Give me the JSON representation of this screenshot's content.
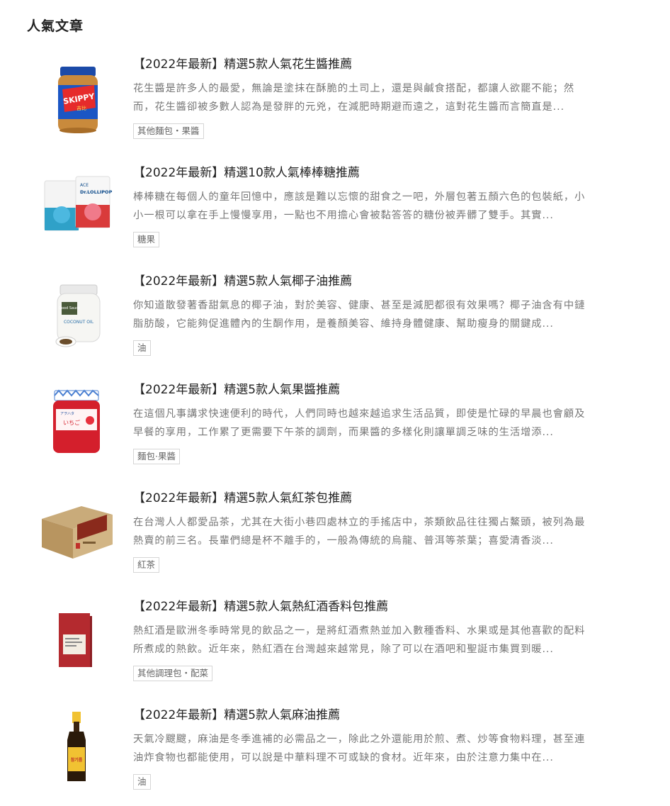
{
  "section": {
    "title": "人氣文章"
  },
  "articles": [
    {
      "title": "【2022年最新】精選5款人氣花生醬推薦",
      "excerpt_line1": "花生醬是許多人的最愛，無論是塗抹在酥脆的土司上，還是與鹹食搭配，都讓人欲罷不能；然",
      "excerpt_line2": "而，花生醬卻被多數人認為是發胖的元兇，在減肥時期避而遠之，這對花生醬而言簡直是...",
      "tag": "其他麵包・果醬",
      "image_brand": "SKIPPY",
      "image_subtext": "吉比"
    },
    {
      "title": "【2022年最新】精選10款人氣棒棒糖推薦",
      "excerpt_line1": "棒棒糖在每個人的童年回憶中，應該是難以忘懷的甜食之一吧，外層包著五顏六色的包裝紙，小",
      "excerpt_line2": "小一根可以拿在手上慢慢享用，一點也不用擔心會被黏答答的糖份被弄髒了雙手。其實...",
      "tag": "糖果",
      "image_brand": "Dr.LOLLIPOP",
      "image_subtext": "ACE"
    },
    {
      "title": "【2022年最新】精選5款人氣椰子油推薦",
      "excerpt_line1": "你知道散發著香甜氣息的椰子油，對於美容、健康、甚至是減肥都很有效果嗎？椰子油含有中鏈",
      "excerpt_line2": "脂肪酸，它能夠促進體內的生酮作用，是養顏美容、維持身體健康、幫助瘦身的關鍵成...",
      "tag": "油",
      "image_brand": "Good Sauce",
      "image_subtext": "COCONUT OIL"
    },
    {
      "title": "【2022年最新】精選5款人氣果醬推薦",
      "excerpt_line1": "在這個凡事講求快速便利的時代，人們同時也越來越追求生活品質，即使是忙碌的早晨也會顧及",
      "excerpt_line2": "早餐的享用，工作累了更需要下午茶的調劑，而果醬的多樣化則讓單調乏味的生活增添...",
      "tag": "麵包·果醬",
      "image_brand": "アヲハタ",
      "image_subtext": "いちご"
    },
    {
      "title": "【2022年最新】精選5款人氣紅茶包推薦",
      "excerpt_line1": "在台灣人人都愛品茶，尤其在大街小巷四處林立的手搖店中，茶類飲品往往獨占鰲頭，被列為最",
      "excerpt_line2": "熱賣的前三名。長輩們總是杯不離手的，一般為傳統的烏龍、普洱等茶葉；喜愛清香淡...",
      "tag": "紅茶",
      "image_brand": "",
      "image_subtext": ""
    },
    {
      "title": "【2022年最新】精選5款人氣熱紅酒香料包推薦",
      "excerpt_line1": "熱紅酒是歐洲冬季時常見的飲品之一，是將紅酒煮熱並加入數種香料、水果或是其他喜歡的配料",
      "excerpt_line2": "所煮成的熱飲。近年來，熱紅酒在台灣越來越常見，除了可以在酒吧和聖誕市集買到暖...",
      "tag": "其他調理包・配菜",
      "image_brand": "",
      "image_subtext": ""
    },
    {
      "title": "【2022年最新】精選5款人氣麻油推薦",
      "excerpt_line1": "天氣冷颼颼，麻油是冬季進補的必需品之一，除此之外還能用於煎、煮、炒等食物料理，甚至連",
      "excerpt_line2": "油炸食物也都能使用，可以說是中華料理不可或缺的食材。近年來，由於注意力集中在...",
      "tag": "油",
      "image_brand": "참기름",
      "image_subtext": ""
    }
  ]
}
